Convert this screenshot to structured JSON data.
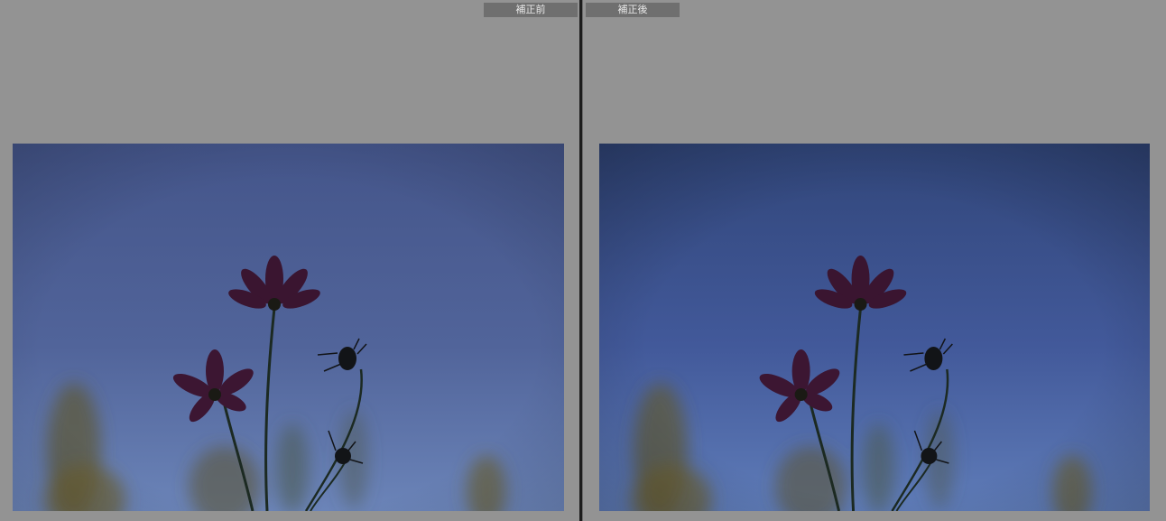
{
  "compare_view": {
    "before_label": "補正前",
    "after_label": "補正後"
  },
  "colors": {
    "background": "#939393",
    "label_bg": "#6f6f6f",
    "divider": "#1c1c1c",
    "before_sky_top": "#44558a",
    "before_sky_bottom": "#6b84b8",
    "after_sky_top": "#31467a",
    "after_sky_bottom": "#5f7cb8"
  },
  "photo": {
    "subject_icon": "cosmos-flower-silhouette"
  }
}
